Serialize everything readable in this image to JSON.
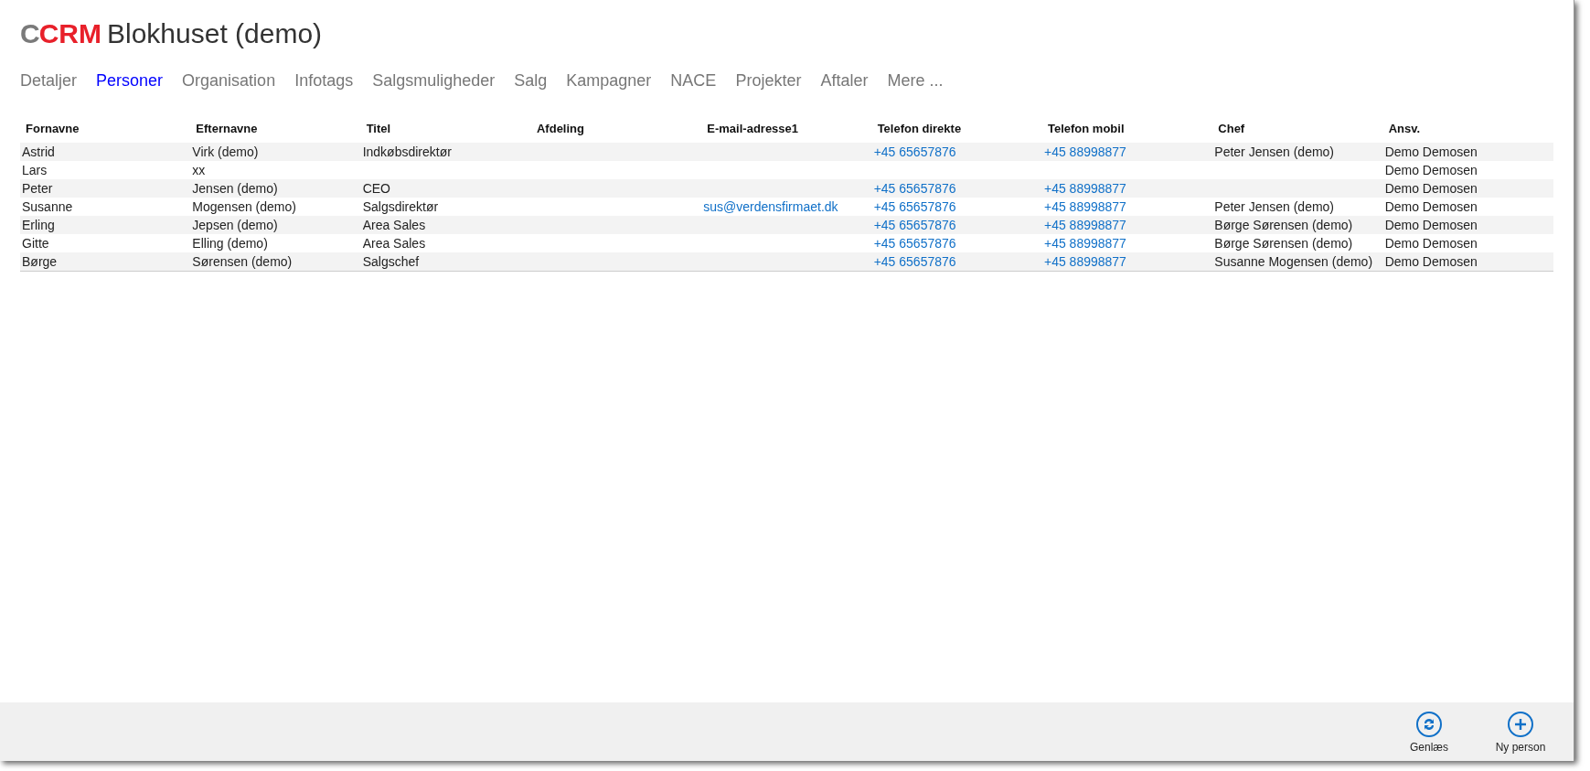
{
  "header": {
    "logo_prefix": "C",
    "logo_name": "CRM",
    "title": "Blokhuset (demo)"
  },
  "tabs": [
    {
      "label": "Detaljer",
      "selected": false
    },
    {
      "label": "Personer",
      "selected": true
    },
    {
      "label": "Organisation",
      "selected": false
    },
    {
      "label": "Infotags",
      "selected": false
    },
    {
      "label": "Salgsmuligheder",
      "selected": false
    },
    {
      "label": "Salg",
      "selected": false
    },
    {
      "label": "Kampagner",
      "selected": false
    },
    {
      "label": "NACE",
      "selected": false
    },
    {
      "label": "Projekter",
      "selected": false
    },
    {
      "label": "Aftaler",
      "selected": false
    },
    {
      "label": "Mere ...",
      "selected": false
    }
  ],
  "table": {
    "columns": [
      {
        "label": "Fornavne",
        "kind": "text"
      },
      {
        "label": "Efternavne",
        "kind": "text"
      },
      {
        "label": "Titel",
        "kind": "text"
      },
      {
        "label": "Afdeling"
      },
      {
        "label": "E-mail-adresse1",
        "kind": "link"
      },
      {
        "label": "Telefon direkte",
        "kind": "link"
      },
      {
        "label": "Telefon mobil",
        "kind": "link"
      },
      {
        "label": "Chef",
        "kind": "text"
      },
      {
        "label": "Ansv.",
        "kind": "text"
      }
    ],
    "rows": [
      {
        "cells": [
          "Astrid",
          "Virk (demo)",
          "Indkøbsdirektør",
          null,
          null,
          "+45 65657876",
          "+45 88998877",
          "Peter Jensen (demo)",
          "Demo Demosen"
        ]
      },
      {
        "cells": [
          "Lars",
          "xx",
          null,
          null,
          null,
          null,
          null,
          null,
          "Demo Demosen"
        ]
      },
      {
        "cells": [
          "Peter",
          "Jensen (demo)",
          "CEO",
          null,
          null,
          "+45 65657876",
          "+45 88998877",
          null,
          "Demo Demosen"
        ]
      },
      {
        "cells": [
          "Susanne",
          "Mogensen (demo)",
          "Salgsdirektør",
          null,
          "sus@verdensfirmaet.dk",
          "+45 65657876",
          "+45 88998877",
          "Peter Jensen (demo)",
          "Demo Demosen"
        ]
      },
      {
        "cells": [
          "Erling",
          "Jepsen (demo)",
          "Area Sales",
          null,
          null,
          "+45 65657876",
          "+45 88998877",
          "Børge Sørensen (demo)",
          "Demo Demosen"
        ]
      },
      {
        "cells": [
          "Gitte",
          "Elling (demo)",
          "Area Sales",
          null,
          null,
          "+45 65657876",
          "+45 88998877",
          "Børge Sørensen (demo)",
          "Demo Demosen"
        ]
      },
      {
        "cells": [
          "Børge",
          "Sørensen (demo)",
          "Salgschef",
          null,
          null,
          "+45 65657876",
          "+45 88998877",
          "Susanne Mogensen (demo)",
          "Demo Demosen"
        ]
      }
    ]
  },
  "app_bar": {
    "buttons": [
      {
        "label": "Genlæs",
        "kind": "refresh"
      },
      {
        "label": "Ny person",
        "kind": "add"
      }
    ]
  }
}
